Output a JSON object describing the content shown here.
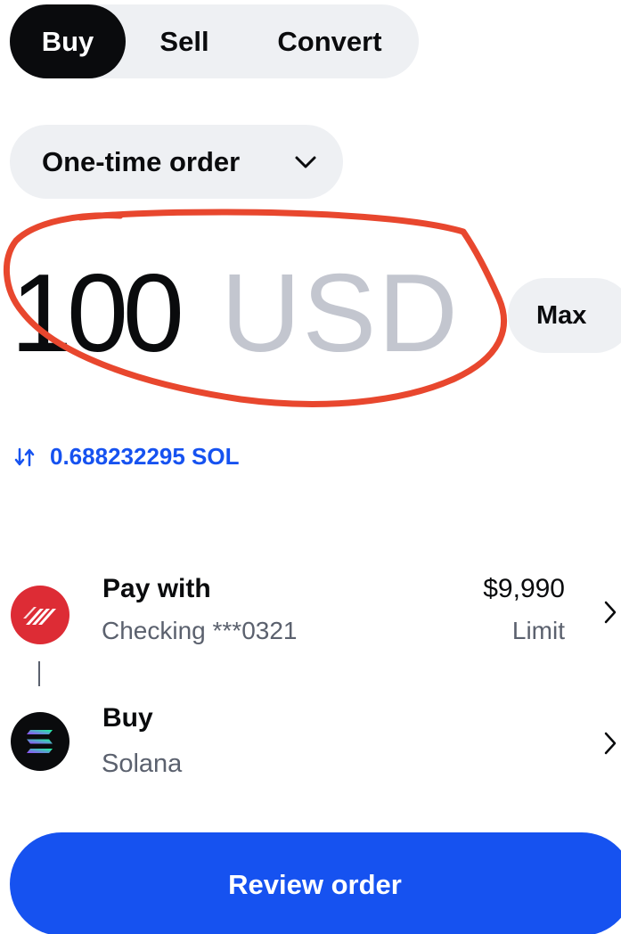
{
  "tabs": [
    {
      "label": "Buy",
      "active": true
    },
    {
      "label": "Sell",
      "active": false
    },
    {
      "label": "Convert",
      "active": false
    }
  ],
  "order_type": {
    "label": "One-time order",
    "icon": "chevron-down-icon"
  },
  "amount": {
    "value": "100",
    "currency": "USD",
    "max_label": "Max"
  },
  "converted": {
    "text": "0.688232295 SOL",
    "icon": "swap-arrows-icon"
  },
  "pay_with": {
    "title": "Pay with",
    "account": "Checking ***0321",
    "limit_amount": "$9,990",
    "limit_label": "Limit",
    "icon": "bank-of-america-icon"
  },
  "buy_asset": {
    "title": "Buy",
    "asset": "Solana",
    "icon": "solana-icon"
  },
  "review_button": {
    "label": "Review order"
  },
  "colors": {
    "accent": "#1652f0",
    "dark": "#0a0b0d",
    "pill_bg": "#eef0f3",
    "muted_text": "#5b616e",
    "currency_gray": "#c3c6cf",
    "annotation_red": "#e8472e",
    "bank_red": "#dd2c35"
  }
}
